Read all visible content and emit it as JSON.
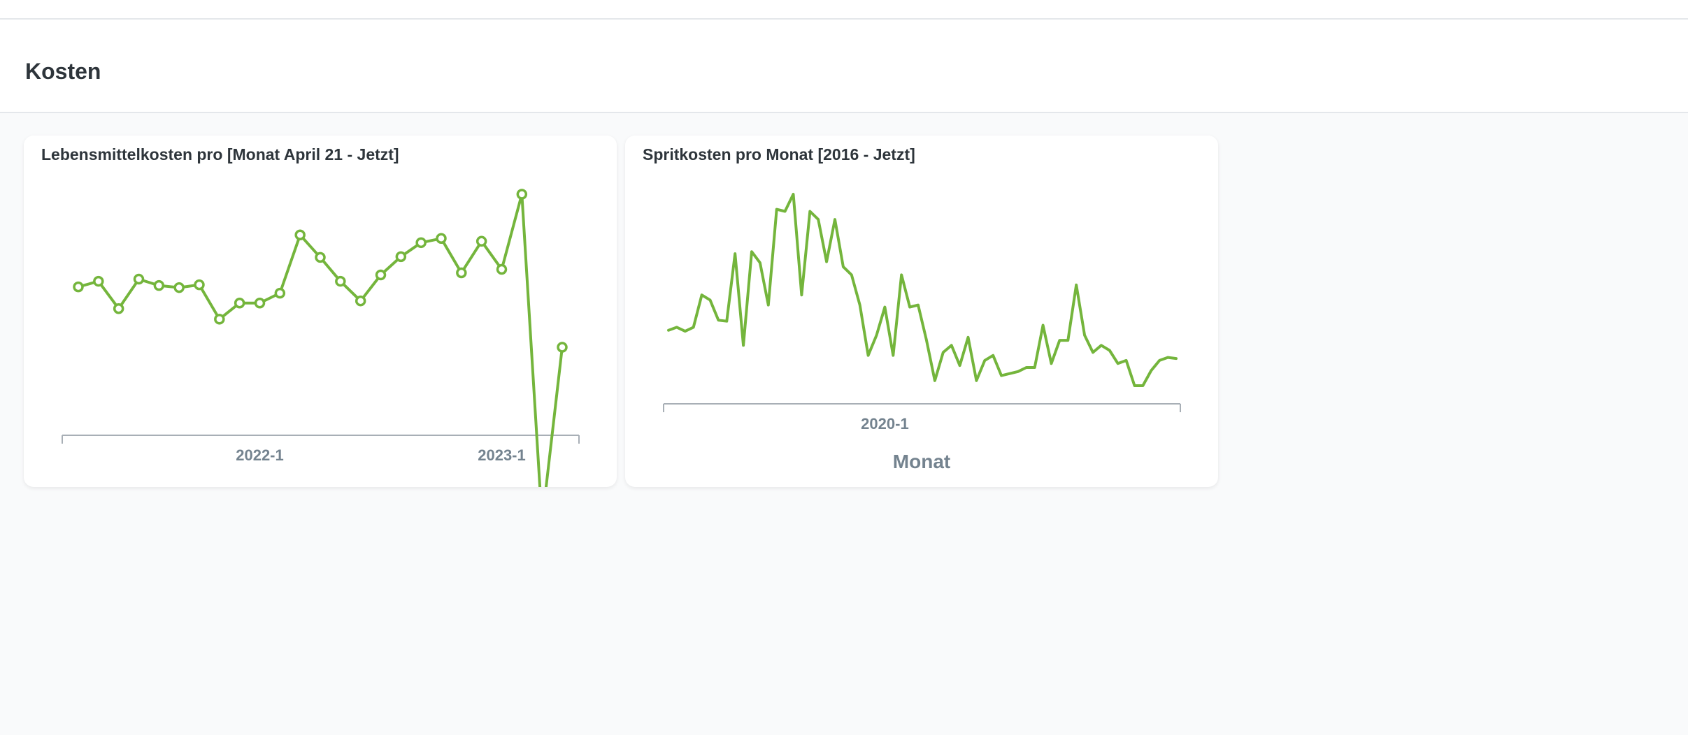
{
  "page": {
    "title": "Kosten"
  },
  "colors": {
    "series": "#74b53c",
    "axis": "#a8afb6",
    "label": "#74838f"
  },
  "cards": [
    {
      "title": "Lebensmittelkosten pro [Monat April 21 - Jetzt]"
    },
    {
      "title": "Spritkosten pro Monat [2016 - Jetzt]"
    }
  ],
  "chart_data": [
    {
      "type": "line",
      "title": "Lebensmittelkosten pro [Monat April 21 - Jetzt]",
      "xlabel": "",
      "ylabel": "",
      "markers": true,
      "grid": false,
      "x": [
        "2021-4",
        "2021-5",
        "2021-6",
        "2021-7",
        "2021-8",
        "2021-9",
        "2021-10",
        "2021-11",
        "2021-12",
        "2022-1",
        "2022-2",
        "2022-3",
        "2022-4",
        "2022-5",
        "2022-6",
        "2022-7",
        "2022-8",
        "2022-9",
        "2022-10",
        "2022-11",
        "2022-12",
        "2023-1",
        "2023-2",
        "2023-3",
        "2023-4"
      ],
      "series": [
        {
          "values": [
            335,
            343,
            304,
            346,
            337,
            334,
            338,
            289,
            312,
            312,
            326,
            409,
            377,
            343,
            315,
            352,
            378,
            398,
            404,
            355,
            400,
            360,
            467,
            0,
            249
          ]
        }
      ],
      "x_ticks": [
        "2022-1",
        "2023-1"
      ]
    },
    {
      "type": "line",
      "title": "Spritkosten pro Monat [2016 - Jetzt]",
      "xlabel": "Monat",
      "ylabel": "",
      "markers": false,
      "grid": false,
      "series": [
        {
          "values": [
            145,
            148,
            144,
            148,
            180,
            175,
            155,
            154,
            221,
            130,
            223,
            212,
            170,
            265,
            263,
            280,
            180,
            263,
            255,
            213,
            255,
            208,
            200,
            170,
            120,
            140,
            168,
            120,
            200,
            168,
            170,
            135,
            95,
            123,
            130,
            110,
            138,
            95,
            115,
            120,
            100,
            102,
            104,
            108,
            108,
            150,
            112,
            135,
            135,
            190,
            140,
            123,
            130,
            125,
            112,
            115,
            90,
            90,
            105,
            115,
            118,
            117
          ]
        }
      ],
      "x_ticks": [
        "2020-1"
      ]
    }
  ]
}
